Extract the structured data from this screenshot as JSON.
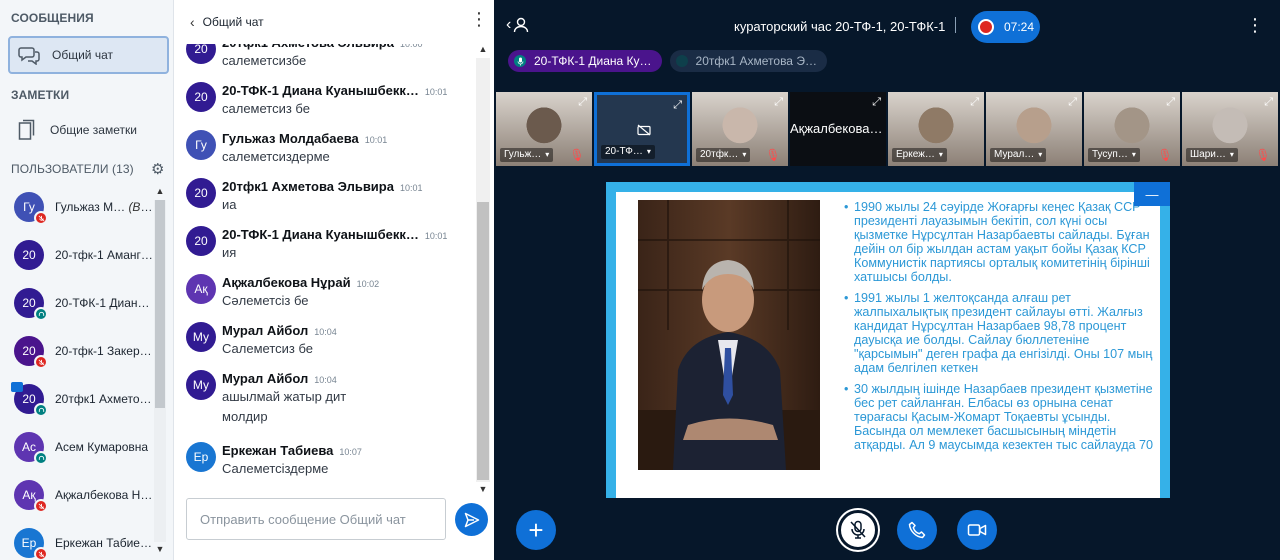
{
  "userlist": {
    "messages_heading": "СООБЩЕНИЯ",
    "public_chat_label": "Общий чат",
    "notes_heading": "ЗАМЕТКИ",
    "shared_notes_label": "Общие заметки",
    "users_heading": "ПОЛЬЗОВАТЕЛИ",
    "users_count": "(13)",
    "users": [
      {
        "initials": "Гу",
        "name": "Гульжаз М…",
        "you": "(Вы)",
        "color": "#3f51b5",
        "status": "muted"
      },
      {
        "initials": "20",
        "name": "20-тфк-1 Аманг…",
        "color": "#311b92",
        "status": "none"
      },
      {
        "initials": "20",
        "name": "20-ТФК-1 Диана…",
        "color": "#311b92",
        "status": "listen"
      },
      {
        "initials": "20",
        "name": "20-тфк-1 Закеро…",
        "color": "#4a148c",
        "status": "muted"
      },
      {
        "initials": "20",
        "name": "20тфк1 Ахметов…",
        "color": "#311b92",
        "status": "listen"
      },
      {
        "initials": "Ас",
        "name": "Асем Кумаровна",
        "color": "#5e35b1",
        "status": "listen"
      },
      {
        "initials": "Ақ",
        "name": "Ақжалбекова Н…",
        "color": "#5e35b1",
        "status": "muted"
      },
      {
        "initials": "Ер",
        "name": "Еркежан Табие…",
        "color": "#1976d2",
        "status": "muted"
      }
    ]
  },
  "chat": {
    "title": "Общий чат",
    "input_placeholder": "Отправить сообщение Общий чат",
    "messages": [
      {
        "initials": "20",
        "color": "#311b92",
        "sender": "20тфк1 Ахметова Эльвира",
        "time": "10:00",
        "lines": [
          "салеметсизбе"
        ]
      },
      {
        "initials": "20",
        "color": "#311b92",
        "sender": "20-ТФК-1 Диана Куанышбекк…",
        "time": "10:01",
        "lines": [
          "салеметсиз бе"
        ]
      },
      {
        "initials": "Гу",
        "color": "#3f51b5",
        "sender": "Гульжаз Молдабаева",
        "time": "10:01",
        "lines": [
          "салеметсиздерме"
        ]
      },
      {
        "initials": "20",
        "color": "#311b92",
        "sender": "20тфк1 Ахметова Эльвира",
        "time": "10:01",
        "lines": [
          "иа"
        ]
      },
      {
        "initials": "20",
        "color": "#311b92",
        "sender": "20-ТФК-1 Диана Куанышбекк…",
        "time": "10:01",
        "lines": [
          "ия"
        ]
      },
      {
        "initials": "Ақ",
        "color": "#5e35b1",
        "sender": "Ақжалбекова Нұрай",
        "time": "10:02",
        "lines": [
          "Сәлеметсіз бе"
        ]
      },
      {
        "initials": "Му",
        "color": "#311b92",
        "sender": "Мурал Айбол",
        "time": "10:04",
        "lines": [
          "Салеметсиз бе"
        ]
      },
      {
        "initials": "Му",
        "color": "#311b92",
        "sender": "Мурал Айбол",
        "time": "10:04",
        "lines": [
          "ашылмай жатыр дит",
          "молдир"
        ]
      },
      {
        "initials": "Ер",
        "color": "#1976d2",
        "sender": "Еркежан Табиева",
        "time": "10:07",
        "lines": [
          "Салеметсіздерме"
        ]
      }
    ]
  },
  "meeting": {
    "title": "кураторский час 20-ТФ-1, 20-ТФК-1",
    "record_time": "07:24"
  },
  "talkers": [
    {
      "name": "20-ТФК-1 Диана Ку…",
      "active": true
    },
    {
      "name": "20тфк1 Ахметова Э…",
      "active": false
    }
  ],
  "video_tiles": [
    {
      "name": "Гульж…",
      "muted": true,
      "selected": false,
      "nocam": false,
      "tone": "#6b5a4d"
    },
    {
      "name": "20-ТФ…",
      "muted": false,
      "selected": true,
      "nocam": true,
      "tone": "#222830"
    },
    {
      "name": "20тфк…",
      "muted": true,
      "selected": false,
      "nocam": false,
      "tone": "#c9b7ab"
    },
    {
      "name": "Ақжалбекова …",
      "muted": false,
      "selected": false,
      "nocam": true,
      "tone": "#000000"
    },
    {
      "name": "Еркеж…",
      "muted": false,
      "selected": false,
      "nocam": false,
      "tone": "#8f7a66"
    },
    {
      "name": "Мурал…",
      "muted": false,
      "selected": false,
      "nocam": false,
      "tone": "#b79f8c"
    },
    {
      "name": "Тусуп…",
      "muted": true,
      "selected": false,
      "nocam": false,
      "tone": "#a39587"
    },
    {
      "name": "Шари…",
      "muted": true,
      "selected": false,
      "nocam": false,
      "tone": "#c4bcb6"
    }
  ],
  "presentation": {
    "bullets": [
      "1990 жылы 24 сәуірде Жоғарғы кеңес Қазақ ССР президенті лауазымын бекітіп, сол күні осы қызметке Нұрсұлтан Назарбаевты сайлады. Бұған дейін ол бір жылдан астам уақыт бойы Қазақ КСР Коммунистік партиясы орталық комитетінің бірінші хатшысы болды.",
      "1991 жылы 1 желтоқсанда алғаш рет жалпыхалықтық президент сайлауы өтті. Жалғыз кандидат Нұрсұлтан Назарбаев 98,78 процент дауысқа ие болды. Сайлау бюллетеніне \"қарсымын\" деген графа да енгізілді. Оны 107 мың адам белгілеп кеткен",
      "30 жылдың ішінде Назарбаев президент қызметіне бес рет сайланған. Елбасы өз орнына сенат төрағасы Қасым-Жомарт Тоқаевты ұсынды. Басында ол мемлекет басшысының міндетін атқарды. Ал 9 маусымда кезектен тыс сайлауда 70"
    ]
  },
  "colors": {
    "accent": "#0f70d7",
    "muted": "#de2721",
    "listen": "#008081",
    "talker_active": "#4a148c",
    "slide_text": "#2c98d6",
    "background": "#06172a"
  }
}
